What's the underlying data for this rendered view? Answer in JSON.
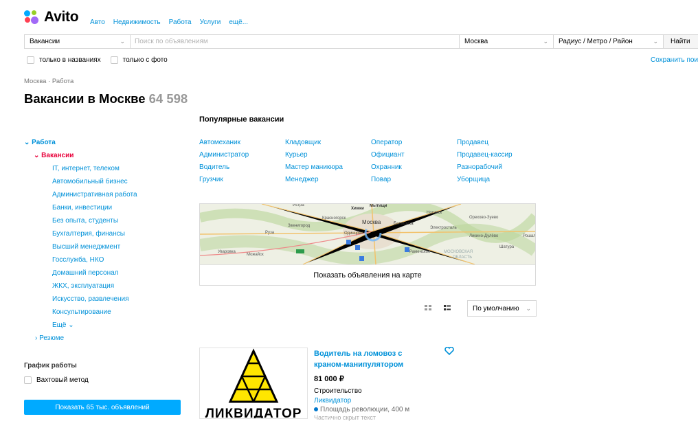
{
  "header": {
    "logo_text": "Avito",
    "nav": [
      "Авто",
      "Недвижимость",
      "Работа",
      "Услуги",
      "ещё..."
    ]
  },
  "search": {
    "category": "Вакансии",
    "placeholder": "Поиск по объявлениям",
    "city": "Москва",
    "radius": "Радиус / Метро / Район",
    "find_label": "Найти"
  },
  "filters": {
    "titles_only": "только в названиях",
    "with_photo": "только с фото",
    "save_search": "Сохранить поиск"
  },
  "breadcrumbs": "Москва · Работа",
  "page": {
    "title": "Вакансии в Москве",
    "count": "64 598"
  },
  "sidebar": {
    "root": "Работа",
    "current": "Вакансии",
    "items": [
      "IT, интернет, телеком",
      "Автомобильный бизнес",
      "Административная работа",
      "Банки, инвестиции",
      "Без опыта, студенты",
      "Бухгалтерия, финансы",
      "Высший менеджмент",
      "Госслужба, НКО",
      "Домашний персонал",
      "ЖКХ, эксплуатация",
      "Искусство, развлечения",
      "Консультирование"
    ],
    "more": "Ещё",
    "resume": "Резюме",
    "schedule_title": "График работы",
    "shift_method": "Вахтовый метод",
    "show_button": "Показать 65 тыс. объявлений"
  },
  "popular": {
    "title": "Популярные вакансии",
    "columns": [
      [
        "Автомеханик",
        "Администратор",
        "Водитель",
        "Грузчик"
      ],
      [
        "Кладовщик",
        "Курьер",
        "Мастер маникюра",
        "Менеджер"
      ],
      [
        "Оператор",
        "Официант",
        "Охранник",
        "Повар"
      ],
      [
        "Продавец",
        "Продавец-кассир",
        "Разнорабочий",
        "Уборщица"
      ]
    ]
  },
  "map": {
    "show_on_map": "Показать объявления на карте",
    "labels": [
      "Истра",
      "Химки",
      "Мытищи",
      "Ногинск",
      "Красногорск",
      "Москва",
      "Балашиха",
      "Орехово-Зуево",
      "Звенигород",
      "Электросталь",
      "Руза",
      "Одинцово",
      "Ликино-Дулёво",
      "Рошаль",
      "Шатура",
      "Уваровка",
      "Можайск",
      "Раменское",
      "МОСКОВСКАЯ ОБЛАСТЬ"
    ]
  },
  "sort": {
    "value": "По умолчанию"
  },
  "listing": {
    "title": "Водитель на ломовоз с краном-манипулятором",
    "price": "81 000 ₽",
    "category": "Строительство",
    "company": "Ликвидатор",
    "metro": "Площадь революции, 400 м",
    "extra": "Частично скрыт текст",
    "logo_word": "ЛИКВИДАТОР",
    "metro_color": "#0077cc"
  },
  "colors": {
    "accent": "#0091d9",
    "red": "#e8003a",
    "button": "#00aaff"
  }
}
